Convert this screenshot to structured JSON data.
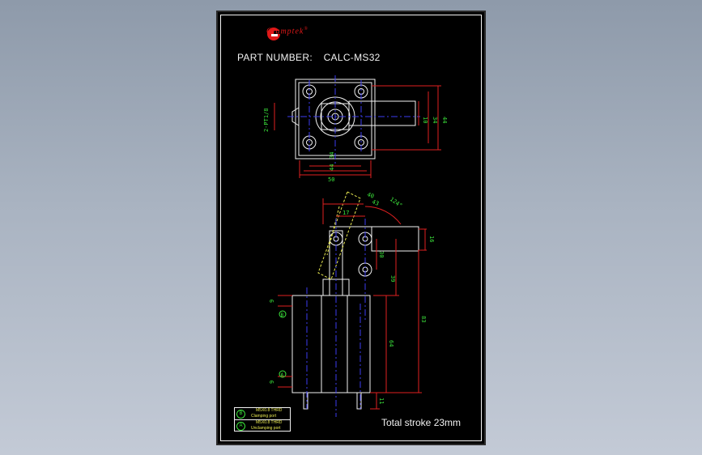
{
  "brand": {
    "name": "Clamptek",
    "mark": "®",
    "logo_color": "#e01818"
  },
  "title": {
    "label": "PART NUMBER:",
    "value": "CALC-MS32"
  },
  "dimensions": {
    "top_view": {
      "thread": "2-PT1/8",
      "d34": "34",
      "d44": "44",
      "d50": "50",
      "d10": "10",
      "d34v": "34",
      "d44v": "44"
    },
    "side_view": {
      "d40": "40",
      "d43": "43",
      "d17": "17",
      "angle": "124°",
      "d16": "16",
      "d30": "30",
      "d39": "39",
      "d83": "83",
      "d64": "64",
      "d9_top": "9",
      "d9_bot": "9",
      "d11": "11",
      "port_a": "A",
      "port_b": "B"
    }
  },
  "legend": [
    {
      "mark": "B",
      "spec": "M5X0.8 THRD",
      "desc": "Clamping port"
    },
    {
      "mark": "A",
      "spec": "M5X0.8 THRD",
      "desc": "Unclamping port"
    }
  ],
  "note": "Total stroke 23mm",
  "colors": {
    "background": "#000000",
    "outline": "#f2f2f2",
    "dimension": "#e02020",
    "centerline": "#3c3cf0",
    "text_dim": "#3ce63c",
    "hidden": "#e8e850"
  }
}
